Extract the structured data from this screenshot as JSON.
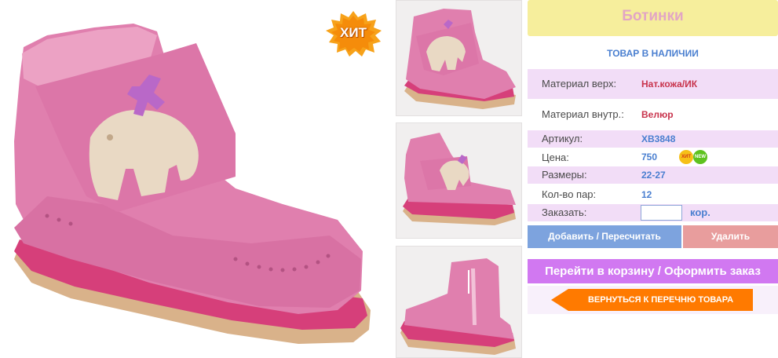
{
  "product": {
    "title": "Ботинки",
    "stock_status": "ТОВАР В НАЛИЧИИ",
    "main_badge": "ХИТ",
    "badge_hit": "ХИТ",
    "badge_new": "NEW"
  },
  "specs": {
    "material_top_label": "Материал верх:",
    "material_top_value": "Нат.кожа/ИК",
    "material_inner_label": "Материал внутр.:",
    "material_inner_value": "Велюр",
    "article_label": "Артикул:",
    "article_value": "ХВ3848",
    "price_label": "Цена:",
    "price_value": "750",
    "sizes_label": "Размеры:",
    "sizes_value": "22-27",
    "pairs_label": "Кол-во пар:",
    "pairs_value": "12",
    "order_label": "Заказать:",
    "order_unit": "кор."
  },
  "order": {
    "quantity_value": "",
    "quantity_placeholder": ""
  },
  "buttons": {
    "add_label": "Добавить / Пересчитать",
    "delete_label": "Удалить",
    "cart_label": "Перейти в корзину / Оформить заказ",
    "back_label": "ВЕРНУТЬСЯ К ПЕРЕЧНЮ ТОВАРА"
  },
  "colors": {
    "title_bg": "#f6ee9c",
    "title_text": "#e2a5c5",
    "row_alt": "#f2ddf7",
    "blue_accent": "#4a7fd0",
    "red_value": "#c8334c",
    "add_button": "#7da3de",
    "delete_button": "#e89d9d",
    "cart_button": "#d178f1",
    "back_button": "#ff7a00"
  },
  "icons": {
    "hit_badge": "starburst-hit-badge-icon",
    "back_arrow": "arrow-left-icon"
  }
}
